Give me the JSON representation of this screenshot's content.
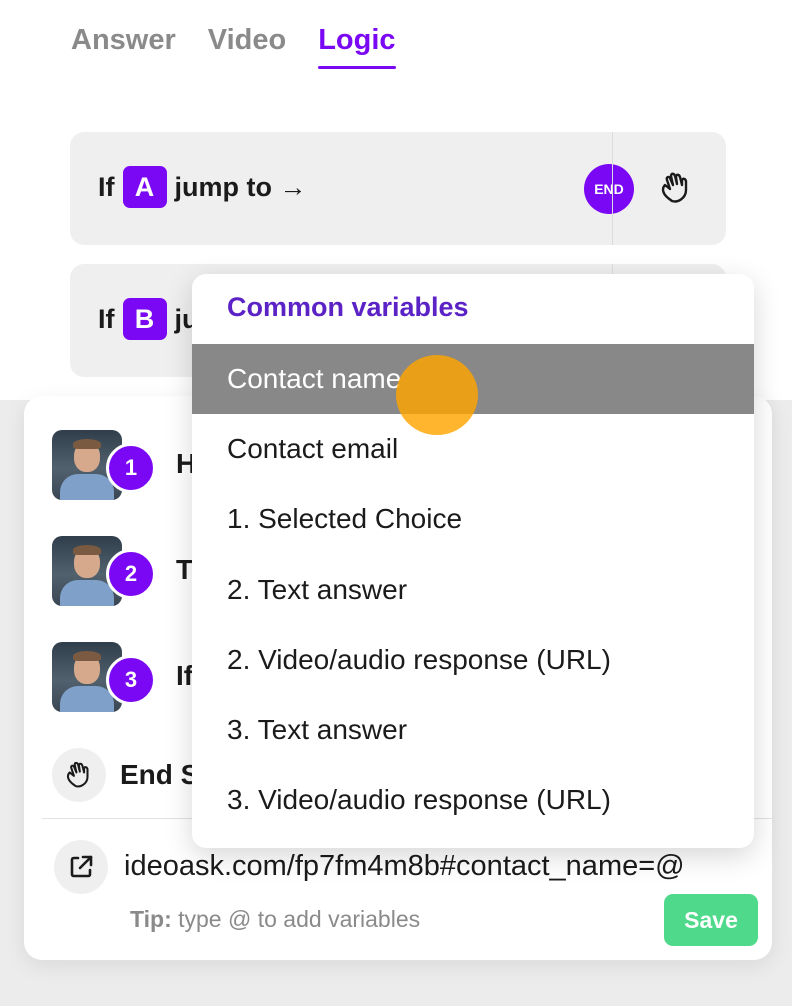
{
  "tabs": [
    {
      "label": "Answer",
      "active": false
    },
    {
      "label": "Video",
      "active": false
    },
    {
      "label": "Logic",
      "active": true
    }
  ],
  "logic_rows": [
    {
      "prefix": "If",
      "letter": "A",
      "suffix": "jump to →",
      "end_label": "END",
      "icon": "wave-hand-icon"
    },
    {
      "prefix": "If",
      "letter": "B",
      "suffix": "ju"
    }
  ],
  "questions": [
    {
      "number": "1",
      "text": "H"
    },
    {
      "number": "2",
      "text": "T"
    },
    {
      "number": "3",
      "text": "If"
    }
  ],
  "end_item": {
    "label": "End S",
    "icon": "wave-hand-icon"
  },
  "url_field": {
    "value": "ideoask.com/fp7fm4m8b#contact_name=@",
    "icon": "external-link-icon"
  },
  "tip": {
    "label": "Tip:",
    "text": "type @ to add variables"
  },
  "save_label": "Save",
  "dropdown": {
    "header": "Common variables",
    "items": [
      "Contact name",
      "Contact email",
      "1. Selected Choice",
      "2. Text answer",
      "2. Video/audio response (URL)",
      "3. Text answer",
      "3. Video/audio response (URL)"
    ],
    "highlighted_index": 0
  },
  "colors": {
    "accent": "#7b08f5",
    "save": "#4fd98a",
    "header": "#5b22c6",
    "highlight": "#888888",
    "cursor": "#ffa500"
  }
}
